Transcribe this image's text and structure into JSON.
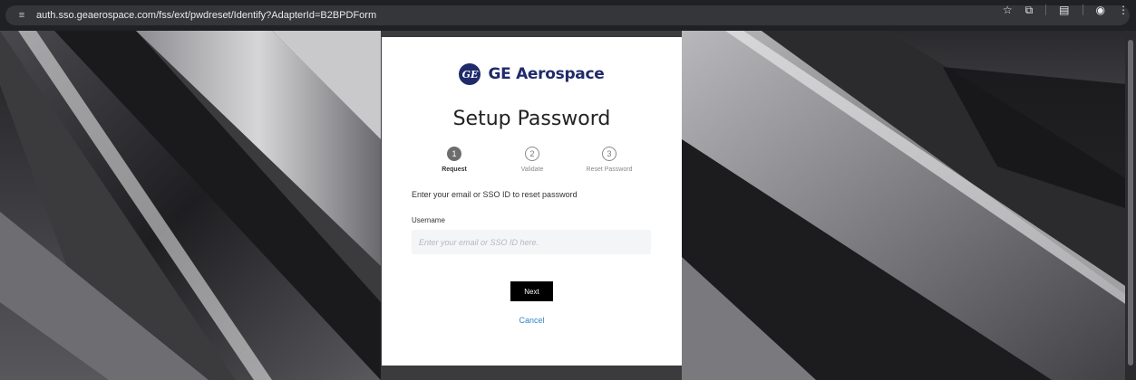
{
  "browser": {
    "url": "auth.sso.geaerospace.com/fss/ext/pwdreset/Identify?AdapterId=B2BPDForm",
    "site_icon": "≡",
    "icons": {
      "bookmark": "☆",
      "extensions": "⧉",
      "reading": "▤",
      "profile": "◉",
      "menu": "⋮"
    }
  },
  "brand": {
    "logo_text": "GE",
    "name": "GE Aerospace",
    "color": "#1f2a6b"
  },
  "page": {
    "title": "Setup Password",
    "instruction": "Enter your email or SSO ID to reset password"
  },
  "steps": [
    {
      "number": "1",
      "label": "Request"
    },
    {
      "number": "2",
      "label": "Validate"
    },
    {
      "number": "3",
      "label": "Reset Password"
    }
  ],
  "form": {
    "username_label": "Username",
    "username_value": "",
    "username_placeholder": "Enter your email or SSO ID here.",
    "next_label": "Next",
    "cancel_label": "Cancel"
  },
  "colors": {
    "link": "#2f86c8",
    "button": "#000000"
  }
}
